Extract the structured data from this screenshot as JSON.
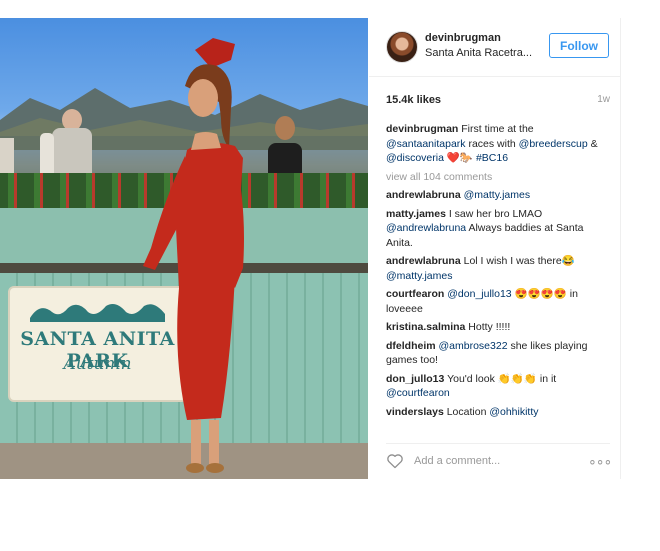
{
  "post": {
    "header": {
      "username": "devinbrugman",
      "location": "Santa Anita Racetra...",
      "follow_label": "Follow"
    },
    "photo": {
      "sign_title": "SANTA ANITA PARK",
      "sign_subtitle": "Autumn"
    },
    "likes": "15.4k likes",
    "time": "1w",
    "caption": {
      "user": "devinbrugman",
      "text_1": "First time at the",
      "mention_1": "@santaanitapark",
      "text_2": "races with",
      "mention_2": "@breederscup",
      "text_3": "&",
      "mention_3": "@discoveria",
      "emoji": "❤️🐎",
      "hashtag": "#BC16"
    },
    "view_all": "view all 104 comments",
    "comments": [
      {
        "user": "andrewlabruna",
        "parts": [
          {
            "t": "@matty.james",
            "m": true
          }
        ]
      },
      {
        "user": "matty.james",
        "parts": [
          {
            "t": "I saw her bro LMAO ",
            "m": false
          },
          {
            "t": "@andrewlabruna",
            "m": true
          },
          {
            "t": " Always baddies at Santa Anita.",
            "m": false
          }
        ]
      },
      {
        "user": "andrewlabruna",
        "parts": [
          {
            "t": "Lol I wish I was there😂 ",
            "m": false
          },
          {
            "t": "@matty.james",
            "m": true
          }
        ]
      },
      {
        "user": "courtfearon",
        "parts": [
          {
            "t": "@don_jullo13",
            "m": true
          },
          {
            "t": " 😍😍😍😍 in loveeee",
            "m": false
          }
        ]
      },
      {
        "user": "kristina.salmina",
        "parts": [
          {
            "t": "Hotty !!!!!",
            "m": false
          }
        ]
      },
      {
        "user": "dfeldheim",
        "parts": [
          {
            "t": "@ambrose322",
            "m": true
          },
          {
            "t": " she likes playing games too!",
            "m": false
          }
        ]
      },
      {
        "user": "don_jullo13",
        "parts": [
          {
            "t": "You'd look 👏👏👏 in it ",
            "m": false
          },
          {
            "t": "@courtfearon",
            "m": true
          }
        ]
      },
      {
        "user": "vinderslays",
        "parts": [
          {
            "t": "Location ",
            "m": false
          },
          {
            "t": "@ohhikitty",
            "m": true
          }
        ]
      }
    ],
    "add_comment_placeholder": "Add a comment...",
    "more_icon": "more-dots-icon",
    "colors": {
      "accent": "#3897f0",
      "mention": "#003569",
      "muted": "#999999",
      "dress": "#c42a1c"
    }
  }
}
